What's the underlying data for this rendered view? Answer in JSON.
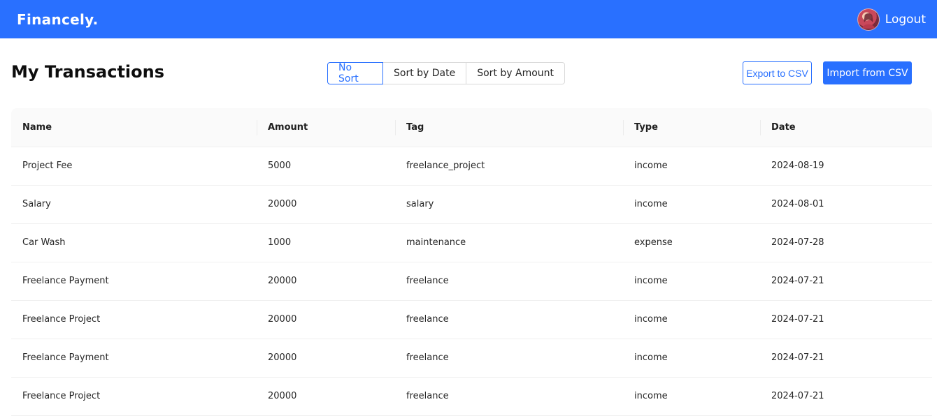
{
  "navbar": {
    "brand": "Financely.",
    "logout_label": "Logout",
    "avatar_icon": "user-avatar",
    "color": "#2970ff"
  },
  "page": {
    "title": "My Transactions"
  },
  "sort": {
    "options": [
      "No Sort",
      "Sort by Date",
      "Sort by Amount"
    ],
    "selected": "No Sort"
  },
  "actions": {
    "export_label": "Export to CSV",
    "import_label": "Import from CSV"
  },
  "table": {
    "columns": [
      "Name",
      "Amount",
      "Tag",
      "Type",
      "Date"
    ],
    "rows": [
      [
        "Project Fee",
        "5000",
        "freelance_project",
        "income",
        "2024-08-19"
      ],
      [
        "Salary",
        "20000",
        "salary",
        "income",
        "2024-08-01"
      ],
      [
        "Car Wash",
        "1000",
        "maintenance",
        "expense",
        "2024-07-28"
      ],
      [
        "Freelance Payment",
        "20000",
        "freelance",
        "income",
        "2024-07-21"
      ],
      [
        "Freelance Project",
        "20000",
        "freelance",
        "income",
        "2024-07-21"
      ],
      [
        "Freelance Payment",
        "20000",
        "freelance",
        "income",
        "2024-07-21"
      ],
      [
        "Freelance Project",
        "20000",
        "freelance",
        "income",
        "2024-07-21"
      ]
    ]
  }
}
